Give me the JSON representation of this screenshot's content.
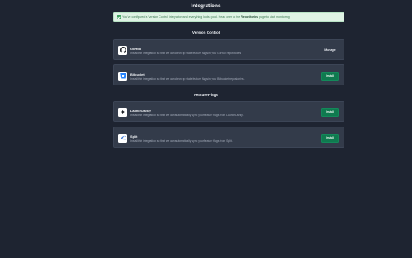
{
  "page": {
    "title": "Integrations"
  },
  "alert": {
    "text_before": "You've configured a Version Control integration and everything looks good. Head over to the",
    "link": "Repositories",
    "text_after": "page to start monitoring.",
    "icon": "check-icon",
    "color": "#dff3e4"
  },
  "sections": {
    "version_control": "Version Control",
    "feature_flags": "Feature Flags"
  },
  "integrations": [
    {
      "name": "GitHub",
      "description": "Install this integration so that we can clean up stale feature flags in your GitHub repositories.",
      "action": "Manage",
      "icon": "github-icon"
    },
    {
      "name": "Bitbucket",
      "description": "Install this integration so that we can clean up stale feature flags in your Bitbucket repositories.",
      "action": "Install",
      "icon": "bitbucket-icon"
    },
    {
      "name": "LaunchDarkly",
      "description": "Install this integration so that we can automatically sync your feature flags from LaunchDarkly.",
      "action": "Install",
      "icon": "launchdarkly-icon"
    },
    {
      "name": "Split",
      "description": "Install this integration so that we can automatically sync your feature flags from Split.",
      "action": "Install",
      "icon": "split-icon"
    }
  ],
  "colors": {
    "background": "#1e2431",
    "card": "#333b4a",
    "install_button": "#0f7a4f",
    "bitbucket": "#2684ff",
    "split": "#2a6bd6"
  }
}
